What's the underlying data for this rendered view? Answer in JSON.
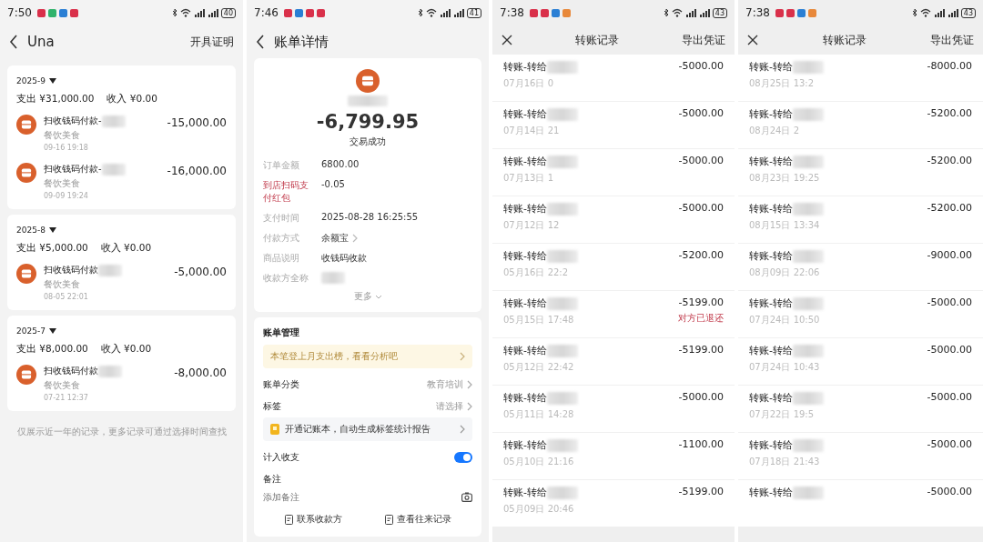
{
  "ledger_screen": {
    "status_bar": {
      "time": "7:50",
      "notifications": [
        {
          "color": "#d9304a"
        },
        {
          "color": "#2fb36b"
        },
        {
          "color": "#2a7fd4"
        },
        {
          "color": "#d9304a"
        }
      ],
      "battery": "40"
    },
    "header": {
      "title": "Una",
      "action": "开具证明"
    },
    "months": [
      {
        "month": "2025-9",
        "expense": "支出 ¥31,000.00",
        "income": "收入 ¥0.00",
        "items": [
          {
            "title": "扫收钱码付款-",
            "category": "餐饮美食",
            "time": "09-16 19:18",
            "amount": "-15,000.00"
          },
          {
            "title": "扫收钱码付款-",
            "category": "餐饮美食",
            "time": "09-09 19:24",
            "amount": "-16,000.00"
          }
        ]
      },
      {
        "month": "2025-8",
        "expense": "支出 ¥5,000.00",
        "income": "收入 ¥0.00",
        "items": [
          {
            "title": "扫收钱码付款",
            "category": "餐饮美食",
            "time": "08-05 22:01",
            "amount": "-5,000.00"
          }
        ]
      },
      {
        "month": "2025-7",
        "expense": "支出 ¥8,000.00",
        "income": "收入 ¥0.00",
        "items": [
          {
            "title": "扫收钱码付款",
            "category": "餐饮美食",
            "time": "07-21 12:37",
            "amount": "-8,000.00"
          }
        ]
      }
    ],
    "footer": "仅展示近一年的记录，更多记录可通过选择时间查找"
  },
  "bill_detail_screen": {
    "status_bar": {
      "time": "7:46",
      "notifications": [
        {
          "color": "#d9304a"
        },
        {
          "color": "#2a7fd4"
        },
        {
          "color": "#d9304a"
        },
        {
          "color": "#d9304a"
        }
      ],
      "battery": "41"
    },
    "title": "账单详情",
    "amount": "-6,799.95",
    "status": "交易成功",
    "details": [
      {
        "label": "订单金额",
        "value": "6800.00",
        "highlight": false,
        "chevron": false,
        "redacted": false
      },
      {
        "label": "到店扫码支付红包",
        "value": "-0.05",
        "highlight": true,
        "chevron": false,
        "redacted": false
      },
      {
        "label": "支付时间",
        "value": "2025-08-28 16:25:55",
        "highlight": false,
        "chevron": false,
        "redacted": false
      },
      {
        "label": "付款方式",
        "value": "余额宝",
        "highlight": false,
        "chevron": true,
        "redacted": false
      },
      {
        "label": "商品说明",
        "value": "收钱码收款",
        "highlight": false,
        "chevron": false,
        "redacted": false
      },
      {
        "label": "收款方全称",
        "highlight": false,
        "chevron": false,
        "redacted": true
      }
    ],
    "more": "更多",
    "management": {
      "title": "账单管理",
      "insight": "本笔登上月支出榜，看看分析吧",
      "rows": [
        {
          "label": "账单分类",
          "value": "教育培训"
        },
        {
          "label": "标签",
          "value": "请选择"
        }
      ],
      "promo": "开通记账本，自动生成标签统计报告",
      "include_toggle": {
        "label": "计入收支",
        "on": true
      },
      "note": {
        "label": "备注",
        "placeholder": "添加备注"
      }
    },
    "actions": [
      "联系收款方",
      "查看往来记录"
    ]
  },
  "transfer_screens": [
    {
      "status_bar": {
        "time": "7:38",
        "notifications": [
          {
            "color": "#d9304a"
          },
          {
            "color": "#d9304a"
          },
          {
            "color": "#2a7fd4"
          },
          {
            "color": "#e8883a"
          }
        ],
        "battery": "43"
      },
      "title": "转账记录",
      "action": "导出凭证",
      "rows": [
        {
          "title": "转账-转给",
          "time": "07月16日 0",
          "amount": "-5000.00"
        },
        {
          "title": "转账-转给",
          "time": "07月14日 21",
          "amount": "-5000.00"
        },
        {
          "title": "转账-转给",
          "time": "07月13日 1",
          "amount": "-5000.00"
        },
        {
          "title": "转账-转给",
          "time": "07月12日 12",
          "amount": "-5000.00"
        },
        {
          "title": "转账-转给",
          "time": "05月16日 22:2",
          "amount": "-5200.00"
        },
        {
          "title": "转账-转给",
          "time": "05月15日 17:48",
          "amount": "-5199.00",
          "note": "对方已退还"
        },
        {
          "title": "转账-转给",
          "time": "05月12日 22:42",
          "amount": "-5199.00"
        },
        {
          "title": "转账-转给",
          "time": "05月11日 14:28",
          "amount": "-5000.00"
        },
        {
          "title": "转账-转给",
          "time": "05月10日 21:16",
          "amount": "-1100.00"
        },
        {
          "title": "转账-转给",
          "time": "05月09日 20:46",
          "amount": "-5199.00"
        }
      ]
    },
    {
      "status_bar": {
        "time": "7:38",
        "notifications": [
          {
            "color": "#d9304a"
          },
          {
            "color": "#d9304a"
          },
          {
            "color": "#2a7fd4"
          },
          {
            "color": "#e8883a"
          }
        ],
        "battery": "43"
      },
      "title": "转账记录",
      "action": "导出凭证",
      "rows": [
        {
          "title": "转账-转给",
          "time": "08月25日 13:2",
          "amount": "-8000.00"
        },
        {
          "title": "转账-转给",
          "time": "08月24日 2",
          "amount": "-5200.00"
        },
        {
          "title": "转账-转给",
          "time": "08月23日 19:25",
          "amount": "-5200.00"
        },
        {
          "title": "转账-转给",
          "time": "08月15日 13:34",
          "amount": "-5200.00"
        },
        {
          "title": "转账-转给",
          "time": "08月09日 22:06",
          "amount": "-9000.00"
        },
        {
          "title": "转账-转给",
          "time": "07月24日 10:50",
          "amount": "-5000.00"
        },
        {
          "title": "转账-转给",
          "time": "07月24日 10:43",
          "amount": "-5000.00"
        },
        {
          "title": "转账-转给",
          "time": "07月22日 19:5",
          "amount": "-5000.00"
        },
        {
          "title": "转账-转给",
          "time": "07月18日 21:43",
          "amount": "-5000.00"
        },
        {
          "title": "转账-转给",
          "amount": "-5000.00"
        }
      ]
    }
  ]
}
